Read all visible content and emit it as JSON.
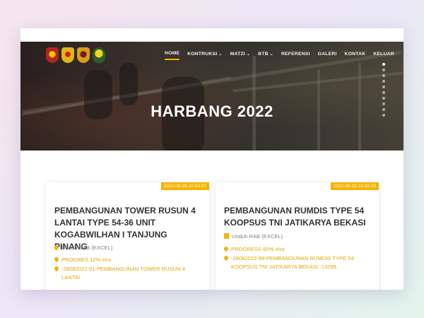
{
  "nav": {
    "items": [
      {
        "label": "HOME",
        "dropdown": false,
        "active": true
      },
      {
        "label": "KONTRUKSI",
        "dropdown": true
      },
      {
        "label": "MATZI",
        "dropdown": true
      },
      {
        "label": "BTB",
        "dropdown": true
      },
      {
        "label": "REFERENSI",
        "dropdown": false
      },
      {
        "label": "GALERI",
        "dropdown": false
      },
      {
        "label": "KONTAK",
        "dropdown": false
      },
      {
        "label": "KELUAR",
        "dropdown": false
      }
    ],
    "caret": "⌄"
  },
  "hero": {
    "title": "HARBANG 2022"
  },
  "cards": [
    {
      "date": "2022-08-26 10:53:37",
      "title": "PEMBANGUNAN TOWER RUSUN 4 LANTAI TYPE 54-36 UNIT KOGABWILHAN I TANJUNG PINANG",
      "rab": "Unduh RAB (EXCEL)",
      "progress": "PROGRES 12%.xlsx",
      "file": "-28082022-91-PEMBANGUNAN TOWER RUSUN 4 LANTAI"
    },
    {
      "date": "2022-08-23 15:38:16",
      "title": "PEMBANGUNAN RUMDIS TYPE 54 KOOPSUS TNI JATIKARYA BEKASI",
      "rab": "Unduh RAB (EXCEL)",
      "progress": "PROGRESS 60%.xlsx",
      "file": "-28082022-88-PEMBANGUNAN RUMDIS TYPE 54 KOOPSUS TNI JATIKARYA BEKASI -13299."
    }
  ],
  "colors": {
    "accent": "#f4b400",
    "title": "#333333",
    "muted": "#808080"
  },
  "icons": [
    "army-emblem-icon",
    "navy-emblem-icon",
    "airforce-emblem-icon",
    "tni-emblem-icon",
    "pin-icon",
    "file-icon"
  ]
}
